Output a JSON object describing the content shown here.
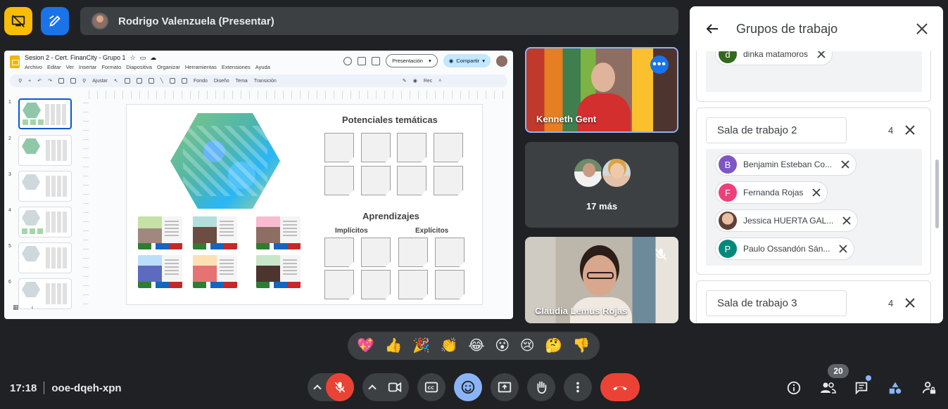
{
  "presenter": {
    "name": "Rodrigo Valenzuela (Presentar)"
  },
  "slides_app": {
    "doc_title": "Sesion 2 - Cert. FinanCity - Grupo 1",
    "menu": [
      "Archivo",
      "Editar",
      "Ver",
      "Insertar",
      "Formato",
      "Diapositiva",
      "Organizar",
      "Herramientas",
      "Extensiones",
      "Ayuda"
    ],
    "present_label": "Presentación",
    "share_label": "Compartir",
    "toolbar": {
      "zoom_label": "Ajustar",
      "background": "Fondo",
      "layout": "Diseño",
      "theme": "Tema",
      "transition": "Transición",
      "rec": "Rec"
    },
    "thumb_numbers": [
      "1",
      "2",
      "3",
      "4",
      "5",
      "6"
    ],
    "slide": {
      "title_top": "Potenciales temáticas",
      "title_mid": "Aprendizajes",
      "sub_left": "Implícitos",
      "sub_right": "Explícitos"
    }
  },
  "participants": {
    "tile1_name": "Kenneth Gent",
    "more_label": "17 más",
    "tile3_name": "Claudia Lemus Rojas"
  },
  "panel": {
    "title": "Grupos de trabajo",
    "group1_member": {
      "initial": "d",
      "name": "dinka matamoros",
      "color": "#33691e"
    },
    "group2": {
      "name": "Sala de trabajo 2",
      "count": "4",
      "members": [
        {
          "initial": "B",
          "name": "Benjamin Esteban Co...",
          "color": "#7e57c2"
        },
        {
          "initial": "F",
          "name": "Fernanda Rojas",
          "color": "#ec407a"
        },
        {
          "initial": "",
          "name": "Jessica HUERTA GAL...",
          "color": "#d7a58a"
        },
        {
          "initial": "P",
          "name": "Paulo Ossandón Sán...",
          "color": "#00897b"
        }
      ]
    },
    "group3": {
      "name": "Sala de trabajo 3",
      "count": "4"
    }
  },
  "reactions": [
    "💖",
    "👍",
    "🎉",
    "👏",
    "😂",
    "😮",
    "😢",
    "🤔",
    "👎"
  ],
  "bottom": {
    "time": "17:18",
    "meeting_code": "ooe-dqeh-xpn",
    "people_count": "20"
  }
}
